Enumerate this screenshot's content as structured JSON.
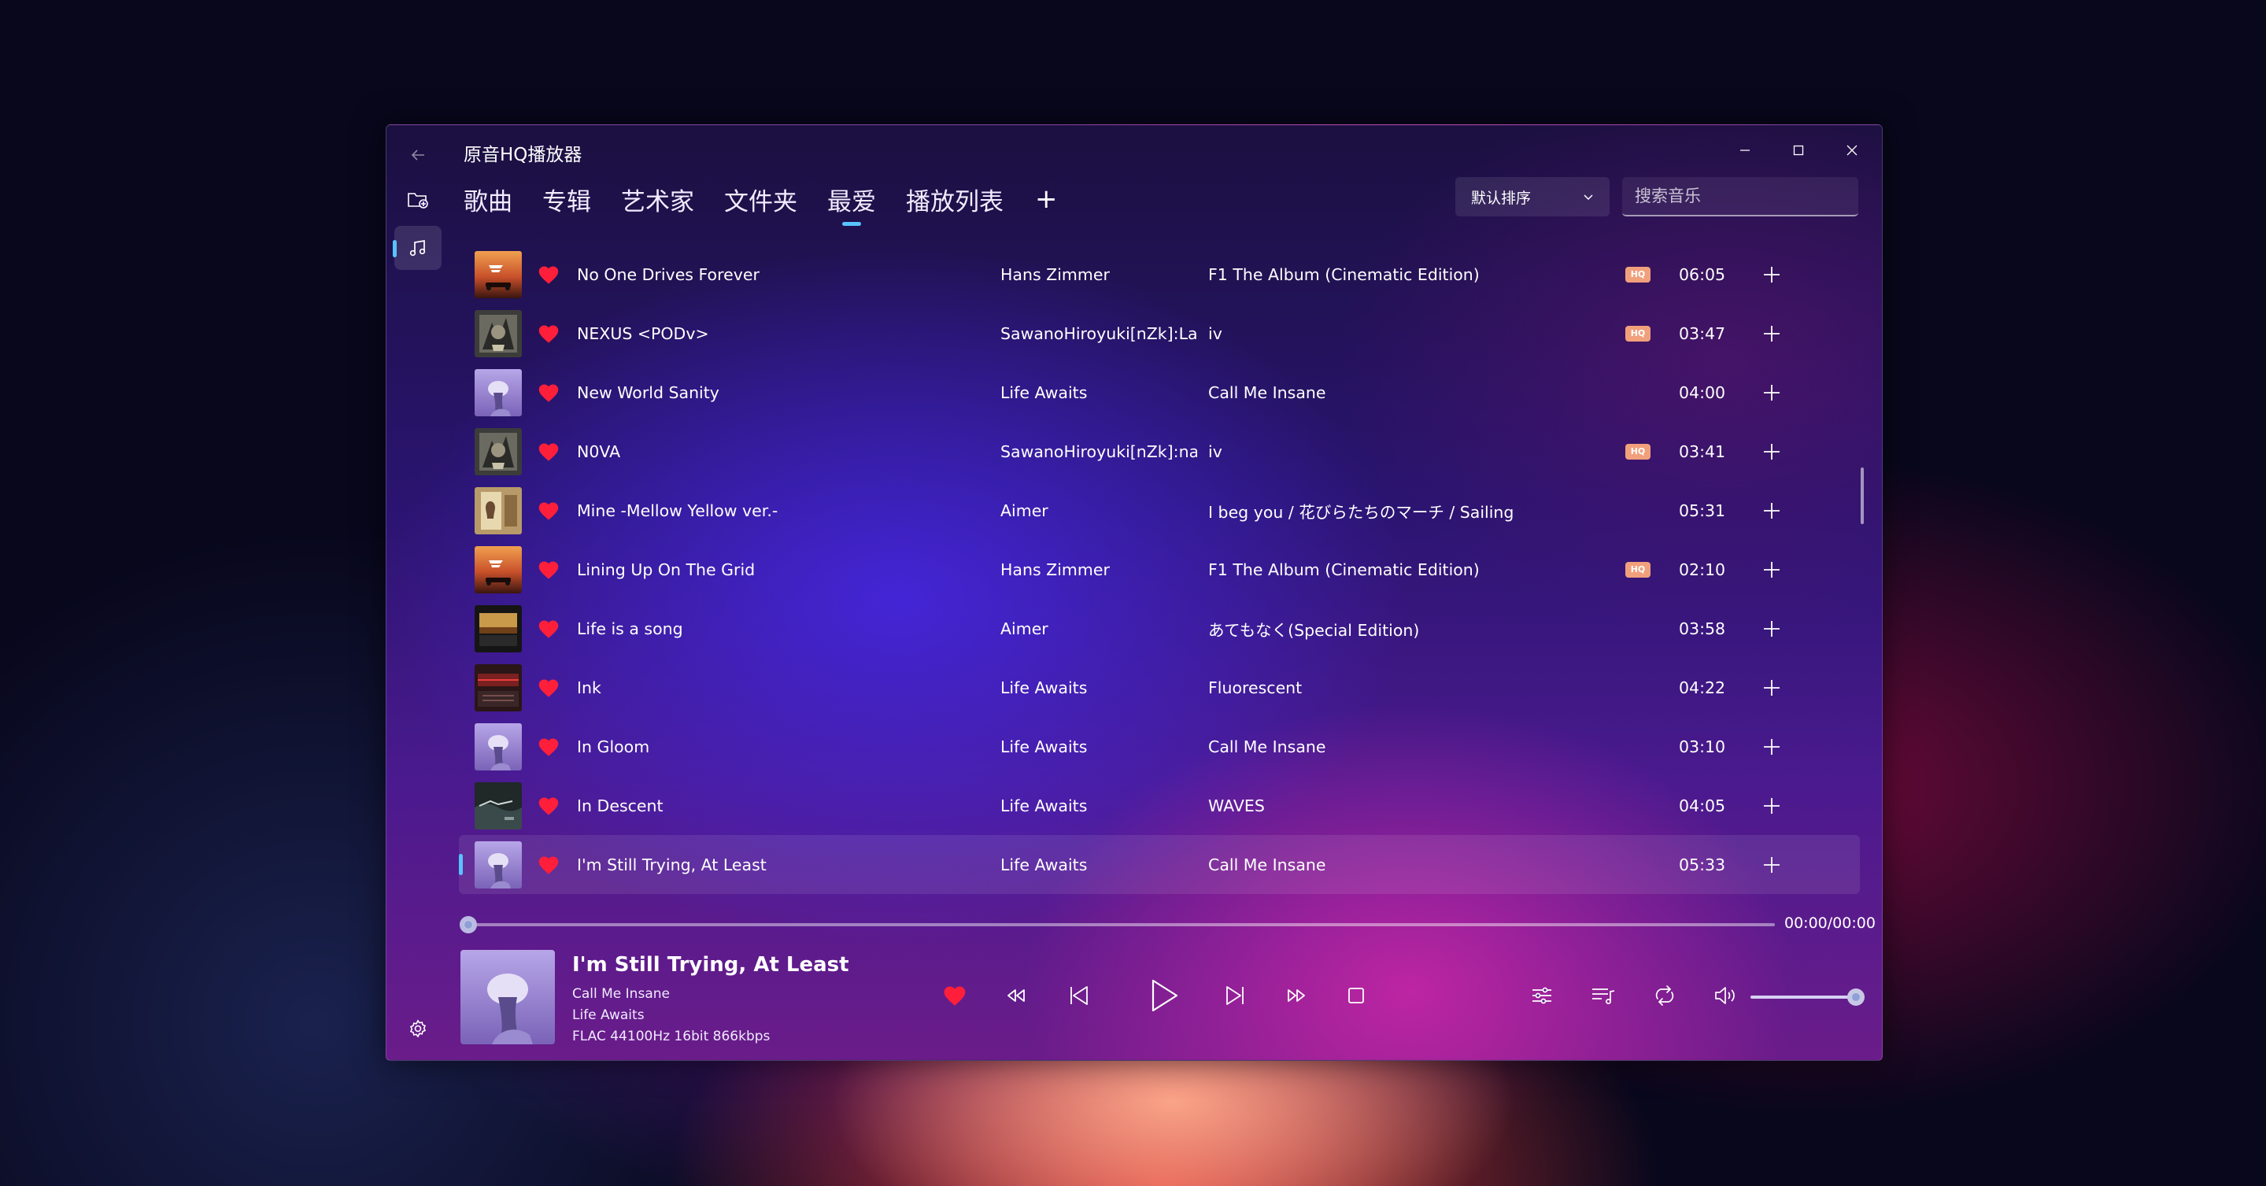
{
  "app": {
    "title": "原音HQ播放器"
  },
  "tabs": [
    {
      "label": "歌曲"
    },
    {
      "label": "专辑"
    },
    {
      "label": "艺术家"
    },
    {
      "label": "文件夹"
    },
    {
      "label": "最爱",
      "active": true
    },
    {
      "label": "播放列表"
    }
  ],
  "tab_add_label": "+",
  "sort": {
    "selected": "默认排序"
  },
  "search": {
    "placeholder": "搜索音乐",
    "value": ""
  },
  "songs": [
    {
      "title": "No One Drives Forever",
      "artist": "Hans Zimmer",
      "album": "F1 The Album (Cinematic Edition)",
      "hq": true,
      "duration": "06:05",
      "cover": "f1"
    },
    {
      "title": "NEXUS <PODv>",
      "artist": "SawanoHiroyuki[nZk]:Laco",
      "album": "iv",
      "hq": true,
      "duration": "03:47",
      "cover": "iv"
    },
    {
      "title": "New World Sanity",
      "artist": "Life Awaits",
      "album": "Call Me Insane",
      "hq": false,
      "duration": "04:00",
      "cover": "insane"
    },
    {
      "title": "N0VA",
      "artist": "SawanoHiroyuki[nZk]:na...",
      "album": "iv",
      "hq": true,
      "duration": "03:41",
      "cover": "iv"
    },
    {
      "title": "Mine -Mellow Yellow ver.-",
      "artist": "Aimer",
      "album": "I beg you / 花びらたちのマーチ / Sailing",
      "hq": false,
      "duration": "05:31",
      "cover": "aimer1"
    },
    {
      "title": "Lining Up On The Grid",
      "artist": "Hans Zimmer",
      "album": "F1 The Album (Cinematic Edition)",
      "hq": true,
      "duration": "02:10",
      "cover": "f1"
    },
    {
      "title": "Life is a song",
      "artist": "Aimer",
      "album": "あてもなく(Special Edition)",
      "hq": false,
      "duration": "03:58",
      "cover": "aimer2"
    },
    {
      "title": "Ink",
      "artist": "Life Awaits",
      "album": "Fluorescent",
      "hq": false,
      "duration": "04:22",
      "cover": "fluor"
    },
    {
      "title": "In Gloom",
      "artist": "Life Awaits",
      "album": "Call Me Insane",
      "hq": false,
      "duration": "03:10",
      "cover": "insane"
    },
    {
      "title": "In Descent",
      "artist": "Life Awaits",
      "album": "WAVES",
      "hq": false,
      "duration": "04:05",
      "cover": "waves"
    },
    {
      "title": "I'm Still Trying, At Least",
      "artist": "Life Awaits",
      "album": "Call Me Insane",
      "hq": false,
      "duration": "05:33",
      "cover": "insane",
      "selected": true
    }
  ],
  "hq_badge_label": "HQ",
  "player": {
    "time": "00:00/00:00",
    "progress": 0,
    "track_title": "I'm Still Trying, At Least",
    "album": "Call Me Insane",
    "artist": "Life Awaits",
    "format": "FLAC 44100Hz 16bit 866kbps",
    "volume": 1.0
  },
  "colors": {
    "accent": "#58c3ff",
    "heart": "#ff1f3a",
    "hq_badge": "#f1a07c"
  },
  "icons": {
    "back": "arrow-left-icon",
    "folder_add": "folder-add-icon",
    "music": "music-note-icon",
    "settings": "gear-icon",
    "minimize": "minimize-icon",
    "maximize": "maximize-icon",
    "close": "close-icon",
    "heart": "heart-icon",
    "add": "plus-icon"
  }
}
